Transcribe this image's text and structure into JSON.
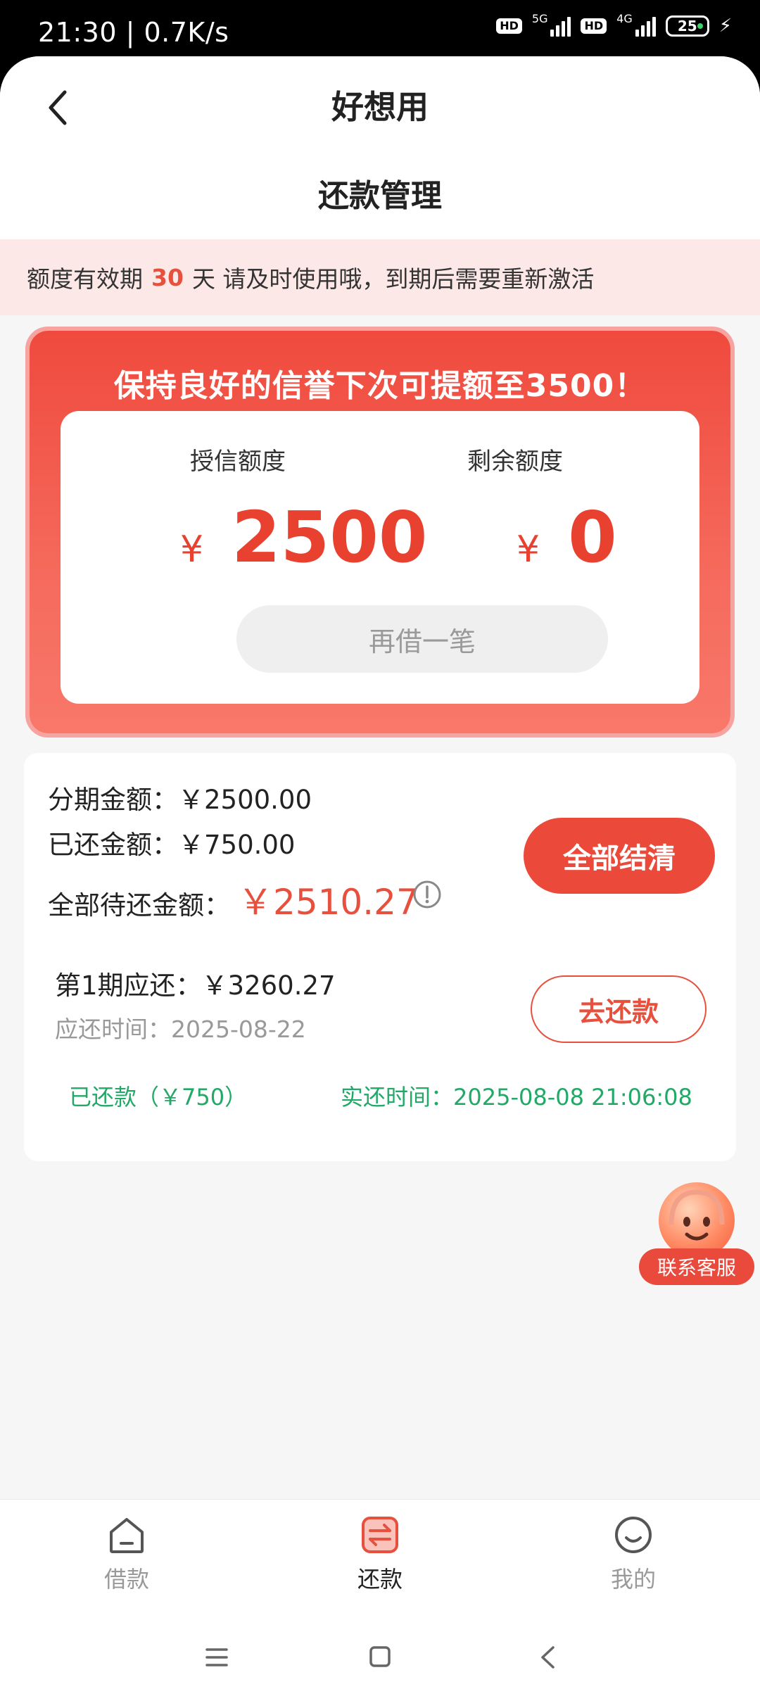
{
  "status_bar": {
    "time_speed": "21:30 | 0.7K/s",
    "hd1": "HD",
    "net1": "5G",
    "hd2": "HD",
    "net2": "4G",
    "battery": "25"
  },
  "header": {
    "app_title": "好想用",
    "page_title": "还款管理"
  },
  "notice": {
    "prefix": "额度有效期",
    "days": "30",
    "suffix": "天 请及时使用哦，到期后需要重新激活"
  },
  "credit_card": {
    "slogan": "保持良好的信誉下次可提额至3500！",
    "granted_label": "授信额度",
    "granted_symbol": "¥",
    "granted_value": "2500",
    "remaining_label": "剩余额度",
    "remaining_symbol": "¥",
    "remaining_value": "0",
    "borrow_again_label": "再借一笔"
  },
  "repayment": {
    "installment_amount": "分期金额：￥2500.00",
    "repaid_amount": "已还金额：￥750.00",
    "total_due_label": "全部待还金额：",
    "total_due_value": "￥2510.27",
    "settle_all_label": "全部结清",
    "period_due": "第1期应还：￥3260.27",
    "due_date": "应还时间：2025-08-22",
    "go_repay_label": "去还款",
    "repaid_status": "已还款（￥750）",
    "actual_time": "实还时间：2025-08-08 21:06:08"
  },
  "customer_service": {
    "label": "联系客服"
  },
  "bottom_nav": {
    "items": [
      {
        "label": "借款",
        "icon": "home-icon"
      },
      {
        "label": "还款",
        "icon": "repay-icon"
      },
      {
        "label": "我的",
        "icon": "profile-icon"
      }
    ],
    "active_index": 1
  },
  "colors": {
    "accent": "#eb4a3b",
    "green": "#22a867"
  }
}
